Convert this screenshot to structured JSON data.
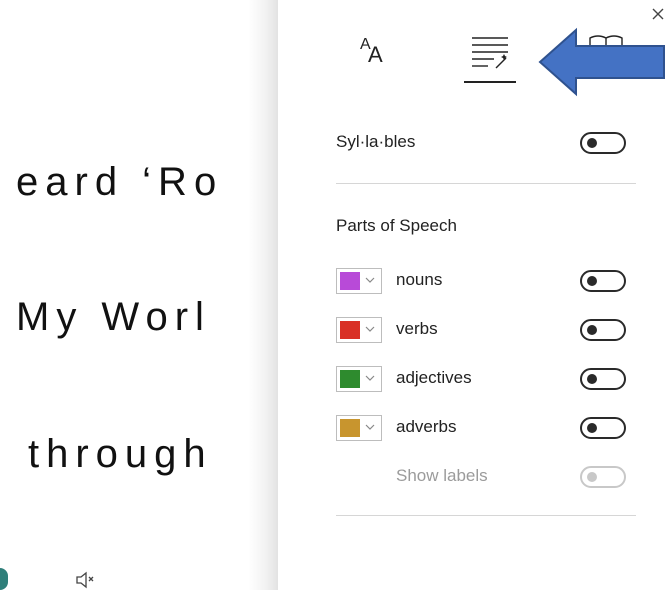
{
  "reader": {
    "lines": [
      "eard ‘Ro",
      "My Worl",
      "through"
    ]
  },
  "panel": {
    "tabs": {
      "text_options_glyph_small": "A",
      "text_options_glyph_big": "A"
    },
    "syllables": {
      "label": "Syl·la·bles",
      "enabled": false
    },
    "parts_of_speech": {
      "heading": "Parts of Speech",
      "items": [
        {
          "label": "nouns",
          "color": "#b84ad8",
          "enabled": false
        },
        {
          "label": "verbs",
          "color": "#d93025",
          "enabled": false
        },
        {
          "label": "adjectives",
          "color": "#2e8b2e",
          "enabled": false
        },
        {
          "label": "adverbs",
          "color": "#c8952e",
          "enabled": false
        }
      ],
      "show_labels": {
        "label": "Show labels",
        "enabled": false,
        "disabled": true
      }
    }
  },
  "colors": {
    "arrow_fill": "#4472c4",
    "arrow_stroke": "#2f528f",
    "toggle": "#2a2a2a",
    "divider": "#d6d6d6"
  }
}
